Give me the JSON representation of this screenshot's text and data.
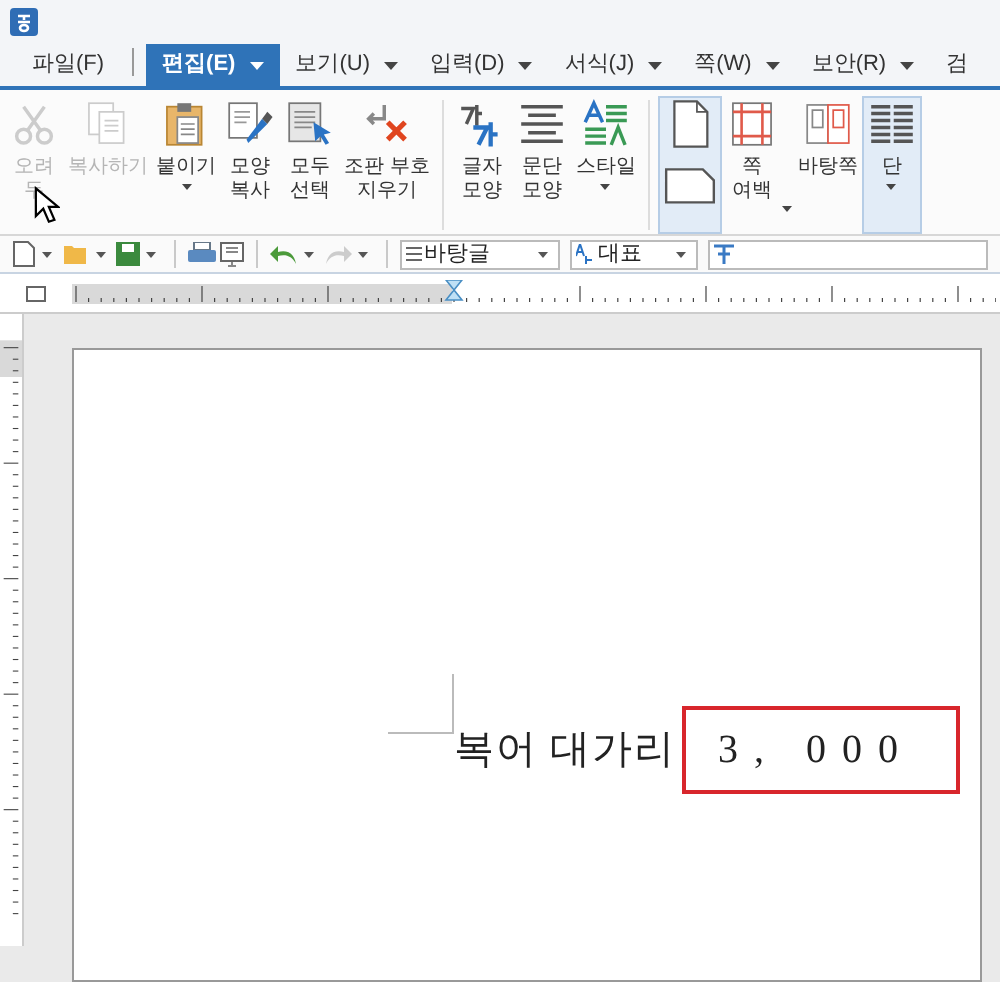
{
  "menu_tabs": [
    {
      "label": "파일(F)",
      "selected": false,
      "has_menu": false
    },
    {
      "label": "편집(E)",
      "selected": true,
      "has_menu": true
    },
    {
      "label": "보기(U)",
      "selected": false,
      "has_menu": true
    },
    {
      "label": "입력(D)",
      "selected": false,
      "has_menu": true
    },
    {
      "label": "서식(J)",
      "selected": false,
      "has_menu": true
    },
    {
      "label": "쪽(W)",
      "selected": false,
      "has_menu": true
    },
    {
      "label": "보안(R)",
      "selected": false,
      "has_menu": true
    },
    {
      "label": "검",
      "selected": false,
      "has_menu": false
    }
  ],
  "ribbon": [
    {
      "kind": "cut",
      "lines": [
        "오려",
        "두"
      ],
      "disabled": true,
      "has_menu": false,
      "selected": false
    },
    {
      "kind": "copy",
      "lines": [
        "복사하기"
      ],
      "disabled": true,
      "has_menu": false,
      "selected": false
    },
    {
      "kind": "paste",
      "lines": [
        "붙이기"
      ],
      "disabled": false,
      "has_menu": true,
      "selected": false
    },
    {
      "kind": "format-painter",
      "lines": [
        "모양",
        "복사"
      ],
      "disabled": false,
      "has_menu": false,
      "selected": false
    },
    {
      "kind": "select-all",
      "lines": [
        "모두",
        "선택"
      ],
      "disabled": false,
      "has_menu": false,
      "selected": false
    },
    {
      "kind": "clear-codes",
      "lines": [
        "조판 부호",
        "지우기"
      ],
      "disabled": false,
      "has_menu": false,
      "selected": false
    },
    {
      "kind": "separator"
    },
    {
      "kind": "char-shape",
      "lines": [
        "글자",
        "모양"
      ],
      "disabled": false,
      "has_menu": false,
      "selected": false
    },
    {
      "kind": "para-shape",
      "lines": [
        "문단",
        "모양"
      ],
      "disabled": false,
      "has_menu": false,
      "selected": false
    },
    {
      "kind": "style",
      "lines": [
        "스타일"
      ],
      "disabled": false,
      "has_menu": true,
      "selected": false
    },
    {
      "kind": "separator"
    },
    {
      "kind": "orientation",
      "disabled": false,
      "selected": true
    },
    {
      "kind": "margin",
      "lines": [
        "쪽",
        "여백"
      ],
      "disabled": false,
      "has_menu": true,
      "selected": false
    },
    {
      "kind": "master-page",
      "lines": [
        "바탕쪽"
      ],
      "disabled": false,
      "has_menu": false,
      "selected": false
    },
    {
      "kind": "columns",
      "lines": [
        "단"
      ],
      "disabled": false,
      "has_menu": true,
      "selected": true
    }
  ],
  "toolbar": {
    "style_value": "바탕글",
    "font_value": "대표"
  },
  "document": {
    "text": "복어 대가리",
    "field_value": "3, 000"
  }
}
